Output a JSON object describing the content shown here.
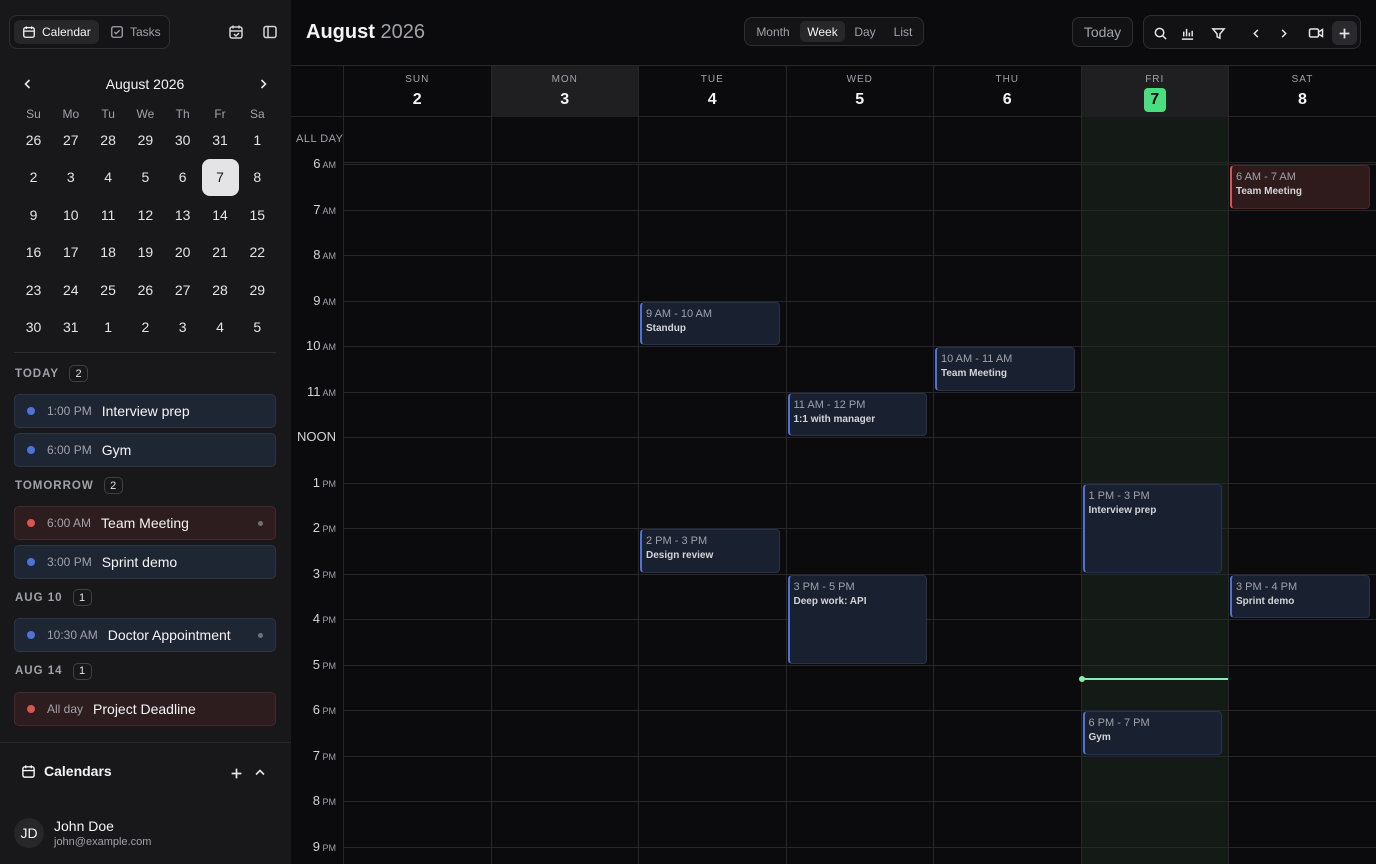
{
  "sidebar": {
    "tabs": [
      {
        "label": "Calendar",
        "icon": "calendar-icon",
        "active": true
      },
      {
        "label": "Tasks",
        "icon": "checkbox-icon",
        "active": false
      }
    ],
    "mini_calendar": {
      "title": "August 2026",
      "weekdays": [
        "Su",
        "Mo",
        "Tu",
        "We",
        "Th",
        "Fr",
        "Sa"
      ],
      "weeks": [
        [
          "26",
          "27",
          "28",
          "29",
          "30",
          "31",
          "1"
        ],
        [
          "2",
          "3",
          "4",
          "5",
          "6",
          "7",
          "8"
        ],
        [
          "9",
          "10",
          "11",
          "12",
          "13",
          "14",
          "15"
        ],
        [
          "16",
          "17",
          "18",
          "19",
          "20",
          "21",
          "22"
        ],
        [
          "23",
          "24",
          "25",
          "26",
          "27",
          "28",
          "29"
        ],
        [
          "30",
          "31",
          "1",
          "2",
          "3",
          "4",
          "5"
        ]
      ],
      "selected": "7"
    },
    "agenda": [
      {
        "label": "TODAY",
        "count": "2",
        "events": [
          {
            "time": "1:00 PM",
            "title": "Interview prep",
            "color": "blue"
          },
          {
            "time": "6:00 PM",
            "title": "Gym",
            "color": "blue"
          }
        ]
      },
      {
        "label": "TOMORROW",
        "count": "2",
        "events": [
          {
            "time": "6:00 AM",
            "title": "Team Meeting",
            "color": "red",
            "more": true
          },
          {
            "time": "3:00 PM",
            "title": "Sprint demo",
            "color": "blue"
          }
        ]
      },
      {
        "label": "AUG 10",
        "count": "1",
        "events": [
          {
            "time": "10:30 AM",
            "title": "Doctor Appointment",
            "color": "blue",
            "more": true
          }
        ]
      },
      {
        "label": "AUG 14",
        "count": "1",
        "events": [
          {
            "time": "All day",
            "title": "Project Deadline",
            "color": "red"
          }
        ]
      }
    ],
    "calendars_label": "Calendars",
    "user": {
      "initials": "JD",
      "name": "John Doe",
      "email": "john@example.com"
    }
  },
  "header": {
    "month": "August",
    "year": "2026",
    "views": [
      "Month",
      "Week",
      "Day",
      "List"
    ],
    "active_view": "Week",
    "today_label": "Today"
  },
  "week": {
    "days": [
      {
        "name": "SUN",
        "num": "2"
      },
      {
        "name": "MON",
        "num": "3"
      },
      {
        "name": "TUE",
        "num": "4"
      },
      {
        "name": "WED",
        "num": "5"
      },
      {
        "name": "THU",
        "num": "6"
      },
      {
        "name": "FRI",
        "num": "7",
        "today": true
      },
      {
        "name": "SAT",
        "num": "8"
      }
    ],
    "all_day_label": "ALL DAY",
    "hours": [
      {
        "h": "6",
        "p": "AM"
      },
      {
        "h": "7",
        "p": "AM"
      },
      {
        "h": "8",
        "p": "AM"
      },
      {
        "h": "9",
        "p": "AM"
      },
      {
        "h": "10",
        "p": "AM"
      },
      {
        "h": "11",
        "p": "AM"
      },
      {
        "h": "NOON",
        "p": ""
      },
      {
        "h": "1",
        "p": "PM"
      },
      {
        "h": "2",
        "p": "PM"
      },
      {
        "h": "3",
        "p": "PM"
      },
      {
        "h": "4",
        "p": "PM"
      },
      {
        "h": "5",
        "p": "PM"
      },
      {
        "h": "6",
        "p": "PM"
      },
      {
        "h": "7",
        "p": "PM"
      },
      {
        "h": "8",
        "p": "PM"
      },
      {
        "h": "9",
        "p": "PM"
      }
    ],
    "events": [
      {
        "day": 6,
        "start": 6,
        "end": 7,
        "time": "6 AM - 7 AM",
        "title": "Team Meeting",
        "color": "red"
      },
      {
        "day": 2,
        "start": 9,
        "end": 10,
        "time": "9 AM - 10 AM",
        "title": "Standup",
        "color": "blue"
      },
      {
        "day": 4,
        "start": 10,
        "end": 11,
        "time": "10 AM - 11 AM",
        "title": "Team Meeting",
        "color": "blue"
      },
      {
        "day": 3,
        "start": 11,
        "end": 12,
        "time": "11 AM - 12 PM",
        "title": "1:1 with manager",
        "color": "blue"
      },
      {
        "day": 5,
        "start": 13,
        "end": 15,
        "time": "1 PM - 3 PM",
        "title": "Interview prep",
        "color": "blue"
      },
      {
        "day": 2,
        "start": 14,
        "end": 15,
        "time": "2 PM - 3 PM",
        "title": "Design review",
        "color": "blue"
      },
      {
        "day": 3,
        "start": 15,
        "end": 17,
        "time": "3 PM - 5 PM",
        "title": "Deep work: API",
        "color": "blue"
      },
      {
        "day": 6,
        "start": 15,
        "end": 16,
        "time": "3 PM - 4 PM",
        "title": "Sprint demo",
        "color": "blue"
      },
      {
        "day": 5,
        "start": 18,
        "end": 19,
        "time": "6 PM - 7 PM",
        "title": "Gym",
        "color": "blue"
      }
    ],
    "now_day": 5,
    "now_hour": 17.3
  },
  "colors": {
    "blue": "#4f72d6",
    "red": "#d9534f",
    "today_accent": "#4ade80"
  }
}
